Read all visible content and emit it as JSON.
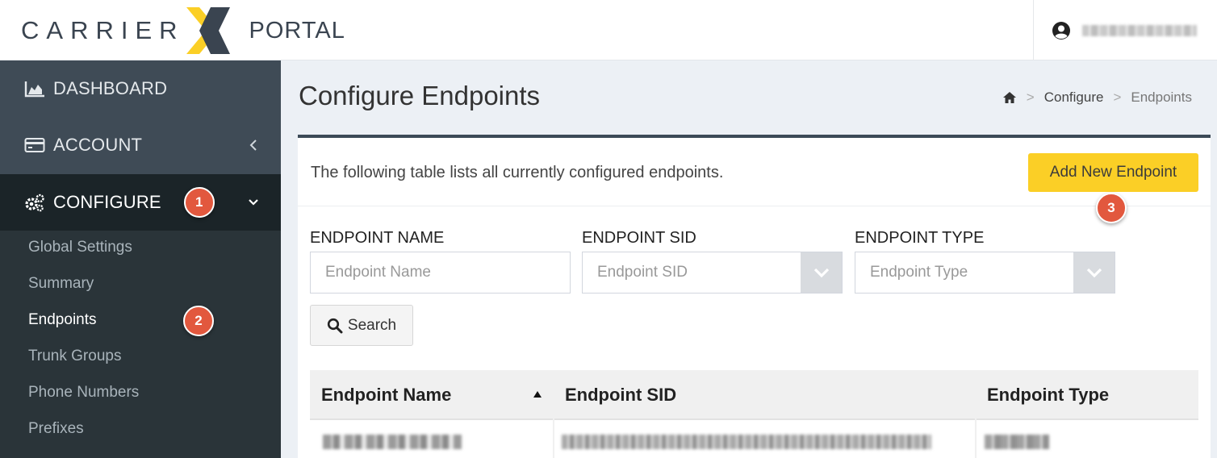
{
  "header": {
    "logo_word1": "CARRIER",
    "logo_word2": "PORTAL",
    "brand_colors": {
      "dark": "#3a4450",
      "yellow": "#fbcf26"
    }
  },
  "sidebar": {
    "items": [
      {
        "label": "DASHBOARD",
        "icon": "area-chart-icon"
      },
      {
        "label": "ACCOUNT",
        "icon": "credit-card-icon"
      },
      {
        "label": "CONFIGURE",
        "icon": "gears-icon"
      }
    ],
    "configure_submenu": [
      {
        "label": "Global Settings"
      },
      {
        "label": "Summary"
      },
      {
        "label": "Endpoints"
      },
      {
        "label": "Trunk Groups"
      },
      {
        "label": "Phone Numbers"
      },
      {
        "label": "Prefixes"
      }
    ]
  },
  "badges": {
    "one": "1",
    "two": "2",
    "three": "3",
    "color": "#e2583e"
  },
  "page": {
    "title": "Configure Endpoints",
    "breadcrumb": {
      "level1": "Configure",
      "level2": "Endpoints",
      "sep": ">"
    }
  },
  "panel": {
    "description": "The following table lists all currently configured endpoints.",
    "add_button": "Add New Endpoint"
  },
  "filters": {
    "name_label": "ENDPOINT NAME",
    "name_placeholder": "Endpoint Name",
    "sid_label": "ENDPOINT SID",
    "sid_placeholder": "Endpoint SID",
    "type_label": "ENDPOINT TYPE",
    "type_placeholder": "Endpoint Type",
    "search_button": "Search"
  },
  "table": {
    "columns": [
      "Endpoint Name",
      "Endpoint SID",
      "Endpoint Type"
    ],
    "sort_column": "Endpoint Name",
    "sort_direction": "ascending"
  }
}
